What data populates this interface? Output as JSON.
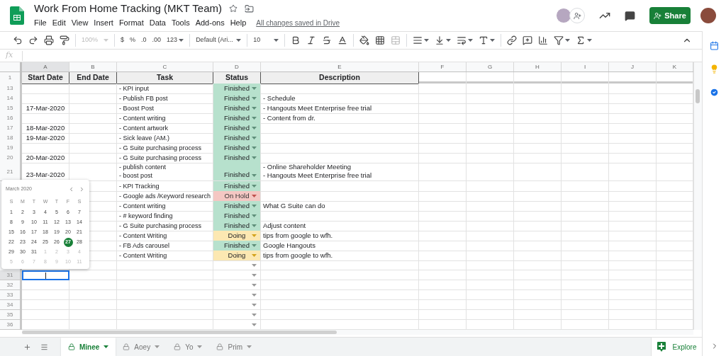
{
  "app": {
    "title": "Work From Home Tracking (MKT Team)",
    "menu": [
      "File",
      "Edit",
      "View",
      "Insert",
      "Format",
      "Data",
      "Tools",
      "Add-ons",
      "Help"
    ],
    "save_status": "All changes saved in Drive",
    "share_label": "Share"
  },
  "toolbar": {
    "zoom": "100%",
    "currency": "$",
    "percent": "%",
    "decrease_decimals": ".0",
    "increase_decimals": ".00",
    "number_format": "123",
    "font": "Default (Ari...",
    "font_size": "10"
  },
  "formula_bar": {
    "label": "fx"
  },
  "columns": [
    {
      "label": "A",
      "selected": true
    },
    {
      "label": "B",
      "selected": false
    },
    {
      "label": "C",
      "selected": false
    },
    {
      "label": "D",
      "selected": false
    },
    {
      "label": "E",
      "selected": false
    },
    {
      "label": "F",
      "selected": false
    },
    {
      "label": "G",
      "selected": false
    },
    {
      "label": "H",
      "selected": false
    },
    {
      "label": "I",
      "selected": false
    },
    {
      "label": "J",
      "selected": false
    },
    {
      "label": "K",
      "selected": false
    }
  ],
  "header_row": {
    "number": "1",
    "cells": [
      "Start Date",
      "End Date",
      "Task",
      "Status",
      "Description"
    ]
  },
  "rows": [
    {
      "number": "13",
      "task": "- KPI input",
      "status": {
        "text": "Finished",
        "kind": "finished"
      },
      "selected": false
    },
    {
      "number": "14",
      "task": "- Publish FB post",
      "status": {
        "text": "Finished",
        "kind": "finished"
      },
      "description": "- Schedule",
      "selected": false
    },
    {
      "number": "15",
      "start_date": "17-Mar-2020",
      "task": "- Boost Post",
      "status": {
        "text": "Finished",
        "kind": "finished"
      },
      "description": "- Hangouts Meet Enterprise free trial",
      "selected": false
    },
    {
      "number": "16",
      "task": "- Content writing",
      "status": {
        "text": "Finished",
        "kind": "finished"
      },
      "description": "- Content from dr.",
      "selected": false
    },
    {
      "number": "17",
      "start_date": "18-Mar-2020",
      "task": "- Content artwork",
      "status": {
        "text": "Finished",
        "kind": "finished"
      },
      "selected": false
    },
    {
      "number": "18",
      "start_date": "19-Mar-2020",
      "task": "- Sick leave (AM.)",
      "status": {
        "text": "Finished",
        "kind": "finished"
      },
      "selected": false
    },
    {
      "number": "19",
      "task": "- G Suite purchasing process",
      "status": {
        "text": "Finished",
        "kind": "finished"
      },
      "selected": false
    },
    {
      "number": "20",
      "start_date": "20-Mar-2020",
      "task": "- G Suite purchasing process",
      "status": {
        "text": "Finished",
        "kind": "finished"
      },
      "selected": false
    },
    {
      "number": "21",
      "start_date": "23-Mar-2020",
      "task": "- publish content\n- boost post",
      "status": {
        "text": "Finished",
        "kind": "finished"
      },
      "description": "- Online Shareholder Meeting\n- Hangouts Meet Enterprise free trial",
      "tall": true,
      "selected": false
    },
    {
      "task": "- KPI Tracking",
      "status": {
        "text": "Finished",
        "kind": "finished"
      }
    },
    {
      "task": "- Google ads /Keyword research",
      "status": {
        "text": "On Hold",
        "kind": "on_hold"
      }
    },
    {
      "task": "- Content writing",
      "status": {
        "text": "Finished",
        "kind": "finished"
      },
      "description": "What G Suite can do"
    },
    {
      "task": "- # keyword finding",
      "status": {
        "text": "Finished",
        "kind": "finished"
      }
    },
    {
      "task": "- G Suite purchasing process",
      "status": {
        "text": "Finished",
        "kind": "finished"
      },
      "description": "Adjust content"
    },
    {
      "task": "- Content Writing",
      "status": {
        "text": "Doing",
        "kind": "doing"
      },
      "description": "tips from google to wfh."
    },
    {
      "task": "- FB Ads carousel",
      "status": {
        "text": "Finished",
        "kind": "finished"
      },
      "description": "Google Hangouts"
    },
    {
      "task": "- Content Writing",
      "status": {
        "text": "Doing",
        "kind": "doing"
      },
      "description": "tips from google to wfh."
    },
    {
      "selected": false
    },
    {
      "number": "31",
      "selected": true
    },
    {
      "number": "32",
      "selected": false
    },
    {
      "number": "33",
      "selected": false
    },
    {
      "number": "34",
      "selected": false
    },
    {
      "number": "35",
      "selected": false
    },
    {
      "number": "36",
      "selected": false
    }
  ],
  "date_picker": {
    "month": "March 2020",
    "weekdays": [
      "S",
      "M",
      "T",
      "W",
      "T",
      "F",
      "S"
    ],
    "days": [
      {
        "label": "1",
        "in_month": true,
        "selected": false
      },
      {
        "label": "2",
        "in_month": true,
        "selected": false
      },
      {
        "label": "3",
        "in_month": true,
        "selected": false
      },
      {
        "label": "4",
        "in_month": true,
        "selected": false
      },
      {
        "label": "5",
        "in_month": true,
        "selected": false
      },
      {
        "label": "6",
        "in_month": true,
        "selected": false
      },
      {
        "label": "7",
        "in_month": true,
        "selected": false
      },
      {
        "label": "8",
        "in_month": true,
        "selected": false
      },
      {
        "label": "9",
        "in_month": true,
        "selected": false
      },
      {
        "label": "10",
        "in_month": true,
        "selected": false
      },
      {
        "label": "11",
        "in_month": true,
        "selected": false
      },
      {
        "label": "12",
        "in_month": true,
        "selected": false
      },
      {
        "label": "13",
        "in_month": true,
        "selected": false
      },
      {
        "label": "14",
        "in_month": true,
        "selected": false
      },
      {
        "label": "15",
        "in_month": true,
        "selected": false
      },
      {
        "label": "16",
        "in_month": true,
        "selected": false
      },
      {
        "label": "17",
        "in_month": true,
        "selected": false
      },
      {
        "label": "18",
        "in_month": true,
        "selected": false
      },
      {
        "label": "19",
        "in_month": true,
        "selected": false
      },
      {
        "label": "20",
        "in_month": true,
        "selected": false
      },
      {
        "label": "21",
        "in_month": true,
        "selected": false
      },
      {
        "label": "22",
        "in_month": true,
        "selected": false
      },
      {
        "label": "23",
        "in_month": true,
        "selected": false
      },
      {
        "label": "24",
        "in_month": true,
        "selected": false
      },
      {
        "label": "25",
        "in_month": true,
        "selected": false
      },
      {
        "label": "26",
        "in_month": true,
        "selected": false
      },
      {
        "label": "27",
        "in_month": true,
        "selected": true
      },
      {
        "label": "28",
        "in_month": true,
        "selected": false
      },
      {
        "label": "29",
        "in_month": true,
        "selected": false
      },
      {
        "label": "30",
        "in_month": true,
        "selected": false
      },
      {
        "label": "31",
        "in_month": true,
        "selected": false
      },
      {
        "label": "1",
        "in_month": false,
        "selected": false
      },
      {
        "label": "2",
        "in_month": false,
        "selected": false
      },
      {
        "label": "3",
        "in_month": false,
        "selected": false
      },
      {
        "label": "4",
        "in_month": false,
        "selected": false
      },
      {
        "label": "5",
        "in_month": false,
        "selected": false
      },
      {
        "label": "6",
        "in_month": false,
        "selected": false
      },
      {
        "label": "7",
        "in_month": false,
        "selected": false
      },
      {
        "label": "8",
        "in_month": false,
        "selected": false
      },
      {
        "label": "9",
        "in_month": false,
        "selected": false
      },
      {
        "label": "10",
        "in_month": false,
        "selected": false
      },
      {
        "label": "11",
        "in_month": false,
        "selected": false
      }
    ]
  },
  "sheet_tabs": [
    {
      "label": "Minee",
      "selected": true
    },
    {
      "label": "Aoey",
      "selected": false
    },
    {
      "label": "Yo",
      "selected": false
    },
    {
      "label": "Prim",
      "selected": false
    }
  ],
  "explore": {
    "label": "Explore"
  }
}
